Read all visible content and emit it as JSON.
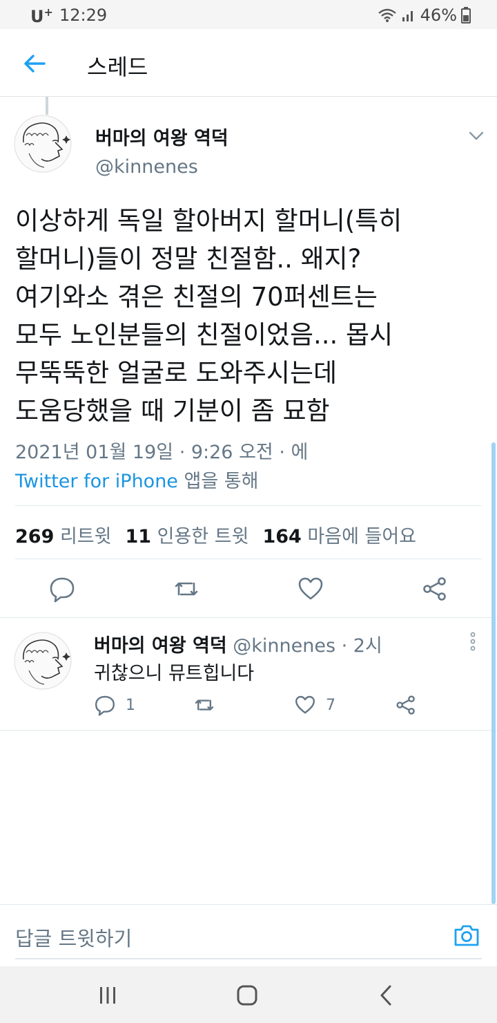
{
  "status_bar": {
    "carrier": "U",
    "carrier_sup": "+",
    "time": "12:29",
    "battery": "46%"
  },
  "header": {
    "title": "스레드"
  },
  "main_tweet": {
    "author_name": "버마의 여왕 역덕",
    "author_handle": "@kinnenes",
    "text_lines": [
      "이상하게 독일 할아버지 할머니(특히",
      "할머니)들이 정말 친절함.. 왜지?",
      "여기와소 겪은 친절의 70퍼센트는",
      "모두 노인분들의 친절이었음... 몹시",
      "무뚝뚝한 얼굴로 도와주시는데",
      "도움당했을 때 기분이 좀 묘함"
    ],
    "timestamp": "2021년 01월 19일 · 9:26 오전 · 에",
    "source_link": "Twitter for iPhone",
    "source_suffix": " 앱을 통해",
    "stats": {
      "retweets_count": "269",
      "retweets_label": " 리트윗",
      "quotes_count": "11",
      "quotes_label": " 인용한 트윗",
      "likes_count": "164",
      "likes_label": " 마음에 들어요"
    }
  },
  "reply_tweet": {
    "author_name": "버마의 여왕 역덕",
    "author_handle": "@kinnenes",
    "time": " · 2시",
    "text": "귀찮으니 뮤트힙니다",
    "reply_count": "1",
    "like_count": "7"
  },
  "compose": {
    "placeholder": "답글 트윗하기"
  },
  "colors": {
    "accent": "#1da1f2",
    "link": "#1b95e0",
    "secondary_text": "#657786",
    "primary_text": "#14171a"
  }
}
